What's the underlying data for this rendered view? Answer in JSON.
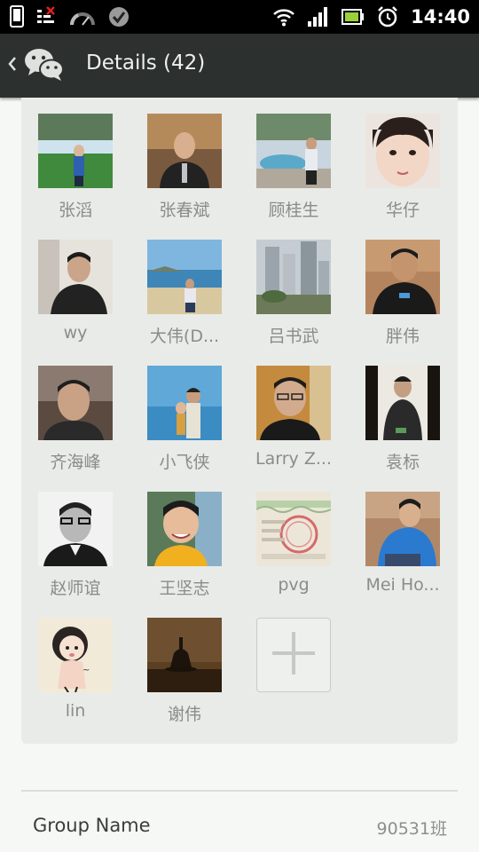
{
  "status_bar": {
    "time": "14:40",
    "icons_left": [
      "phone-icon",
      "sim-error-icon",
      "speedometer-icon",
      "check-badge-icon"
    ],
    "icons_right": [
      "wifi-icon",
      "signal-icon",
      "battery-icon",
      "alarm-icon"
    ]
  },
  "header": {
    "title": "Details (42)",
    "back_icon": "chevron-left-icon",
    "app_icon": "wechat-icon"
  },
  "members": [
    {
      "name": "张滔"
    },
    {
      "name": "张春斌"
    },
    {
      "name": "顾桂生"
    },
    {
      "name": "华仔"
    },
    {
      "name": "wy"
    },
    {
      "name": "大伟(D..."
    },
    {
      "name": "吕书武"
    },
    {
      "name": "胖伟"
    },
    {
      "name": "齐海峰"
    },
    {
      "name": "小飞侠"
    },
    {
      "name": "Larry Z..."
    },
    {
      "name": "袁标"
    },
    {
      "name": "赵师谊"
    },
    {
      "name": "王坚志"
    },
    {
      "name": "pvg"
    },
    {
      "name": "Mei Ho..."
    },
    {
      "name": "lin"
    },
    {
      "name": "谢伟"
    }
  ],
  "add_member": {
    "icon": "plus-icon"
  },
  "group_name": {
    "label": "Group Name",
    "value": "90531班"
  }
}
